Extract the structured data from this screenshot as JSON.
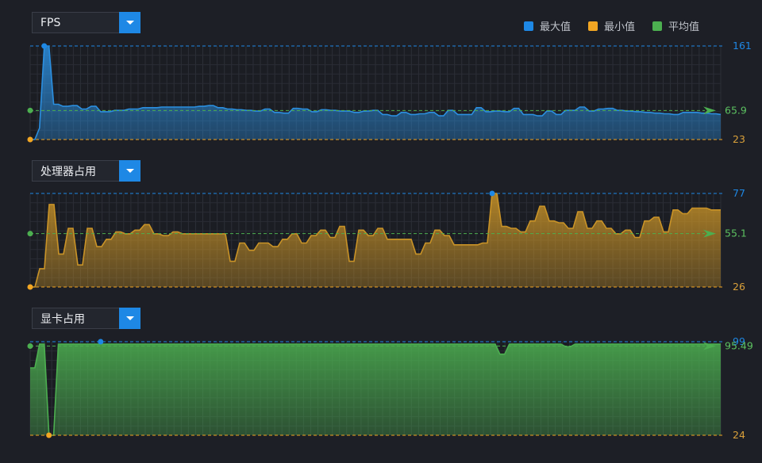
{
  "legend": {
    "max": {
      "label": "最大值",
      "color": "#1e88e5"
    },
    "min": {
      "label": "最小值",
      "color": "#f2a623"
    },
    "avg": {
      "label": "平均值",
      "color": "#4caf50"
    }
  },
  "charts": [
    {
      "id": "fps",
      "selector": "FPS",
      "color": "#2b8fe0",
      "max_label": "161",
      "avg_label": "65.9",
      "min_label": "23"
    },
    {
      "id": "cpu",
      "selector": "处理器占用",
      "color": "#c99327",
      "max_label": "77",
      "avg_label": "55.1",
      "min_label": "26"
    },
    {
      "id": "gpu",
      "selector": "显卡占用",
      "color": "#4caf50",
      "max_label": "99",
      "avg_label": "95.49",
      "min_label": "24"
    }
  ],
  "chart_data": [
    {
      "type": "area",
      "name": "FPS",
      "ylim": [
        23,
        161
      ],
      "max": 161,
      "min": 23,
      "avg": 65.9,
      "values": [
        23,
        23,
        40,
        161,
        161,
        75,
        75,
        72,
        72,
        73,
        73,
        68,
        68,
        72,
        72,
        64,
        64,
        64,
        66,
        66,
        66,
        68,
        68,
        68,
        70,
        70,
        70,
        70,
        71,
        71,
        71,
        71,
        71,
        71,
        71,
        71,
        72,
        72,
        73,
        73,
        70,
        70,
        68,
        68,
        67,
        67,
        66,
        66,
        65,
        65,
        68,
        68,
        63,
        63,
        62,
        62,
        69,
        69,
        68,
        68,
        64,
        64,
        67,
        67,
        66,
        66,
        65,
        65,
        65,
        63,
        63,
        65,
        65,
        66,
        66,
        60,
        60,
        58,
        58,
        63,
        63,
        60,
        60,
        61,
        61,
        63,
        63,
        58,
        58,
        66,
        66,
        60,
        60,
        60,
        60,
        70,
        70,
        64,
        64,
        65,
        65,
        64,
        64,
        69,
        69,
        60,
        60,
        60,
        58,
        58,
        65,
        65,
        60,
        60,
        66,
        66,
        66,
        71,
        71,
        65,
        65,
        68,
        68,
        69,
        69,
        66,
        66,
        65,
        65,
        64,
        64,
        63,
        63,
        62,
        62,
        61,
        61,
        60,
        60,
        63,
        63,
        63,
        63,
        62,
        62,
        61,
        61,
        60
      ]
    },
    {
      "type": "area",
      "name": "处理器占用",
      "ylim": [
        26,
        77
      ],
      "max": 77,
      "min": 26,
      "avg": 55.1,
      "values": [
        26,
        26,
        36,
        36,
        71,
        71,
        44,
        44,
        58,
        58,
        38,
        38,
        58,
        58,
        48,
        48,
        52,
        52,
        56,
        56,
        55,
        55,
        57,
        57,
        60,
        60,
        55,
        55,
        54,
        54,
        56,
        56,
        55,
        55,
        55,
        55,
        55,
        55,
        55,
        55,
        55,
        55,
        40,
        40,
        50,
        50,
        46,
        46,
        50,
        50,
        50,
        48,
        48,
        52,
        52,
        55,
        55,
        50,
        50,
        54,
        54,
        57,
        57,
        53,
        53,
        59,
        59,
        40,
        40,
        57,
        57,
        54,
        54,
        58,
        58,
        52,
        52,
        52,
        52,
        52,
        52,
        44,
        44,
        50,
        50,
        57,
        57,
        54,
        54,
        49,
        49,
        49,
        49,
        49,
        49,
        50,
        50,
        77,
        77,
        59,
        59,
        58,
        58,
        56,
        56,
        62,
        62,
        70,
        70,
        62,
        62,
        61,
        61,
        58,
        58,
        67,
        67,
        58,
        58,
        62,
        62,
        58,
        58,
        55,
        55,
        57,
        57,
        53,
        53,
        62,
        62,
        64,
        64,
        56,
        56,
        68,
        68,
        66,
        66,
        69,
        69,
        69,
        69,
        68,
        68,
        68
      ]
    },
    {
      "type": "area",
      "name": "显卡占用",
      "ylim": [
        24,
        99
      ],
      "max": 99,
      "min": 24,
      "avg": 95.49,
      "values": [
        78,
        78,
        97,
        97,
        24,
        24,
        97,
        97,
        97,
        97,
        97,
        97,
        97,
        97,
        97,
        97,
        97,
        97,
        97,
        97,
        97,
        97,
        97,
        97,
        97,
        97,
        97,
        97,
        97,
        97,
        97,
        97,
        97,
        97,
        97,
        97,
        97,
        97,
        97,
        97,
        97,
        97,
        97,
        97,
        97,
        97,
        97,
        97,
        97,
        97,
        97,
        97,
        97,
        97,
        97,
        97,
        97,
        97,
        97,
        97,
        97,
        97,
        97,
        97,
        97,
        97,
        97,
        97,
        97,
        97,
        97,
        97,
        97,
        97,
        97,
        97,
        97,
        97,
        97,
        97,
        97,
        97,
        97,
        97,
        97,
        97,
        97,
        97,
        97,
        97,
        97,
        97,
        97,
        97,
        97,
        97,
        97,
        97,
        97,
        97,
        97,
        97,
        97,
        97,
        97,
        97,
        97,
        97,
        97,
        97,
        97,
        97,
        97,
        97,
        97,
        97,
        97,
        97,
        97,
        97,
        97,
        97,
        97,
        97,
        97,
        97,
        97,
        97,
        97,
        97,
        97,
        97,
        97,
        97,
        97,
        97,
        97,
        97,
        97,
        97,
        97,
        97,
        97,
        97,
        97,
        97,
        97,
        97
      ],
      "dips": [
        [
          100,
          89
        ],
        [
          101,
          89
        ],
        [
          114,
          95
        ],
        [
          115,
          95
        ]
      ]
    }
  ]
}
